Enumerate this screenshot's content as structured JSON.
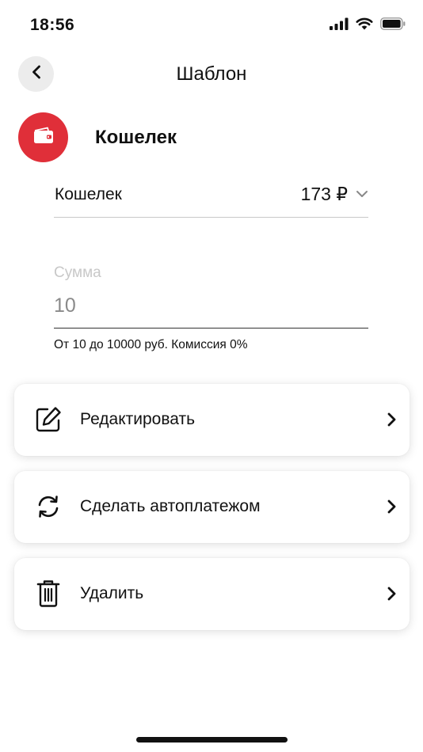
{
  "status_bar": {
    "time": "18:56",
    "icons": [
      "cellular-signal-icon",
      "wifi-icon",
      "battery-icon"
    ]
  },
  "header": {
    "title": "Шаблон",
    "back_icon": "chevron-left-icon"
  },
  "template": {
    "name": "Кошелек",
    "avatar_icon": "wallet-icon",
    "avatar_color": "#e02f39"
  },
  "account_select": {
    "label": "Кошелек",
    "balance": "173 ₽",
    "icon": "chevron-down-icon"
  },
  "amount": {
    "label": "Сумма",
    "value": "10",
    "hint": "От 10 до 10000 руб. Комиссия 0%"
  },
  "actions": [
    {
      "label": "Редактировать",
      "icon": "edit-icon"
    },
    {
      "label": "Сделать автоплатежом",
      "icon": "refresh-icon"
    },
    {
      "label": "Удалить",
      "icon": "trash-icon"
    }
  ]
}
